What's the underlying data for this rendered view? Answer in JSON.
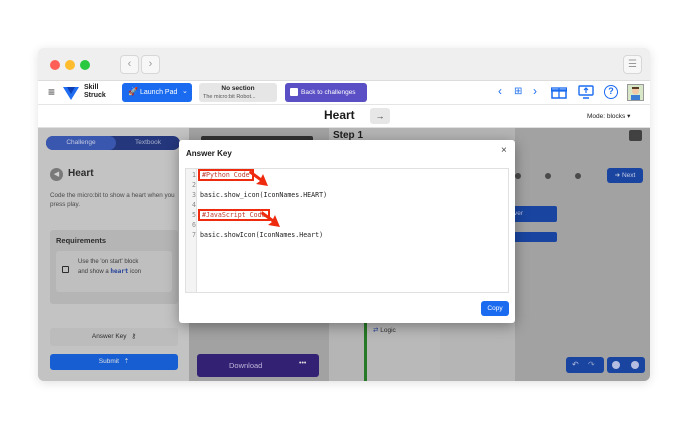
{
  "window": {
    "nav_back": "‹",
    "nav_forward": "›",
    "menu_glyph": "☰"
  },
  "appbar": {
    "menu_glyph": "≡",
    "logo_line1": "Skill",
    "logo_line2": "Struck",
    "launch_pad_label": "Launch Pad",
    "section_title": "No section",
    "section_subtitle": "The micro:bit Robot...",
    "back_label": "Back to challenges",
    "prev_glyph": "‹",
    "grid_glyph": "⊞",
    "next_glyph": "›",
    "help_glyph": "?"
  },
  "subbar": {
    "title": "Heart",
    "arrow_glyph": "→",
    "mode_label": "Mode: blocks ▾"
  },
  "left": {
    "tab_challenge": "Challenge",
    "tab_textbook": "Textbook",
    "heading": "Heart",
    "description": "Code the micro:bit to show a heart when you press play.",
    "requirements_title": "Requirements",
    "req_text_1": "Use the 'on start' block",
    "req_text_2a": "and show a ",
    "req_text_2b": "heart",
    "req_text_2c": " icon",
    "answer_key": "Answer Key",
    "submit": "Submit"
  },
  "workspace": {
    "step": "Step 1",
    "next": "Next",
    "logic": "Logic",
    "download": "Download",
    "more": "•••",
    "partial_ver": "ver"
  },
  "modal": {
    "title": "Answer Key",
    "close": "×",
    "lines": [
      {
        "n": "1",
        "text": "#Python Code"
      },
      {
        "n": "2",
        "text": ""
      },
      {
        "n": "3",
        "text": "basic.show_icon(IconNames.HEART)"
      },
      {
        "n": "4",
        "text": ""
      },
      {
        "n": "5",
        "text": "#JavaScript Code"
      },
      {
        "n": "6",
        "text": ""
      },
      {
        "n": "7",
        "text": "basic.showIcon(IconNames.Heart)"
      }
    ],
    "copy": "Copy"
  },
  "colors": {
    "accent_blue": "#1565e8",
    "purple": "#4b2fa3",
    "annotation_red": "#ee2a0f"
  }
}
